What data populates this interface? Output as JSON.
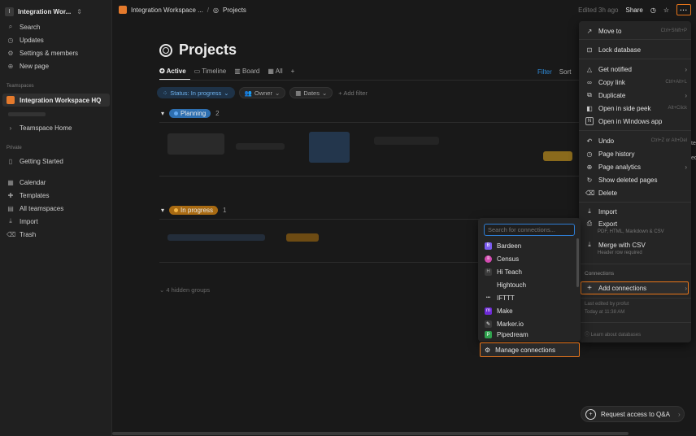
{
  "sidebar": {
    "workspace_badge": "I",
    "workspace_name": "Integration Wor...",
    "workspace_chevron": "⇕",
    "items_top": [
      {
        "icon": "search-icon",
        "glyph": "⌕",
        "label": "Search"
      },
      {
        "icon": "clock-icon",
        "glyph": "◷",
        "label": "Updates"
      },
      {
        "icon": "gear-icon",
        "glyph": "⚙",
        "label": "Settings & members"
      },
      {
        "icon": "plus-circle-icon",
        "glyph": "⊕",
        "label": "New page"
      }
    ],
    "teamspaces_label": "Teamspaces",
    "active_teamspace": "Integration Workspace HQ",
    "teamspace_home": "Teamspace Home",
    "private_label": "Private",
    "getting_started": "Getting Started",
    "items_bottom": [
      {
        "icon": "calendar-icon",
        "glyph": "▦",
        "label": "Calendar"
      },
      {
        "icon": "templates-icon",
        "glyph": "✚",
        "label": "Templates"
      },
      {
        "icon": "teamspaces-icon",
        "glyph": "▤",
        "label": "All teamspaces"
      },
      {
        "icon": "import-icon",
        "glyph": "⤓",
        "label": "Import"
      },
      {
        "icon": "trash-icon",
        "glyph": "🗑",
        "label": "Trash"
      }
    ]
  },
  "topbar": {
    "crumb_workspace": "Integration Workspace ...",
    "crumb_sep": "/",
    "crumb_page": "Projects",
    "edited": "Edited 3h ago",
    "share": "Share",
    "more": "···"
  },
  "main": {
    "title": "Projects",
    "views": [
      "Active",
      "Timeline",
      "Board",
      "All"
    ],
    "add_view": "+",
    "filter": "Filter",
    "sort": "Sort",
    "filters": {
      "status": "Status: In progress",
      "owner": "Owner",
      "dates": "Dates",
      "add": "+ Add filter"
    },
    "groups": [
      {
        "label": "Planning",
        "count": "2",
        "color": "#2e6fb0",
        "dot": "#62a8ef"
      },
      {
        "label": "In progress",
        "count": "1",
        "color": "#a86a12",
        "dot": "#f3b546"
      }
    ],
    "hidden_groups": "4 hidden groups"
  },
  "menu": {
    "items": [
      {
        "icon": "move-icon",
        "glyph": "↗",
        "label": "Move to",
        "shortcut": "Ctrl+Shift+P"
      },
      {
        "icon": "lock-icon",
        "glyph": "🔒",
        "label": "Lock database",
        "shortcut": ""
      },
      {
        "icon": "bell-icon",
        "glyph": "🔔",
        "label": "Get notified",
        "arrow": "›"
      },
      {
        "icon": "link-icon",
        "glyph": "🔗",
        "label": "Copy link",
        "shortcut": "Ctrl+Alt+L"
      },
      {
        "icon": "duplicate-icon",
        "glyph": "⧉",
        "label": "Duplicate",
        "arrow": "›"
      },
      {
        "icon": "side-peek-icon",
        "glyph": "◧",
        "label": "Open in side peek",
        "shortcut": "Alt+Click"
      },
      {
        "icon": "windows-app-icon",
        "glyph": "N",
        "label": "Open in Windows app",
        "shortcut": ""
      },
      {
        "icon": "undo-icon",
        "glyph": "↶",
        "label": "Undo",
        "shortcut": "Ctrl+Z or Alt+Del"
      },
      {
        "icon": "history-icon",
        "glyph": "◷",
        "label": "Page history",
        "shortcut": ""
      },
      {
        "icon": "analytics-icon",
        "glyph": "⊕",
        "label": "Page analytics",
        "arrow": "›"
      },
      {
        "icon": "deleted-pages-icon",
        "glyph": "↻",
        "label": "Show deleted pages",
        "shortcut": ""
      },
      {
        "icon": "delete-icon",
        "glyph": "🗑",
        "label": "Delete",
        "shortcut": ""
      },
      {
        "icon": "import-icon",
        "glyph": "⤓",
        "label": "Import",
        "shortcut": ""
      },
      {
        "icon": "export-icon",
        "glyph": "⎙",
        "label": "Export",
        "sub": "PDF, HTML, Markdown & CSV"
      },
      {
        "icon": "merge-icon",
        "glyph": "⤓",
        "label": "Merge with CSV",
        "sub": "Header row required"
      }
    ],
    "connections_label": "Connections",
    "add_connections": "Add connections",
    "add_connections_glyph": "+",
    "last_edited_by": "Last edited by profut",
    "last_edited_time": "Today at 11:38 AM",
    "learn": "Learn about databases"
  },
  "connections": {
    "placeholder": "Search for connections...",
    "items": [
      {
        "label": "Bardeen",
        "color": "#7b5cf0",
        "glyph": "B"
      },
      {
        "label": "Census",
        "color": "#d34bb1",
        "glyph": "≡"
      },
      {
        "label": "Hi Teach",
        "color": "#3a3a3a",
        "glyph": "H"
      },
      {
        "label": "Hightouch",
        "color": "#252525",
        "glyph": ""
      },
      {
        "label": "IFTTT",
        "color": "#252525",
        "glyph": "•••"
      },
      {
        "label": "Make",
        "color": "#6d2ad6",
        "glyph": "m"
      },
      {
        "label": "Marker.io",
        "color": "#3a3a3a",
        "glyph": "✎"
      },
      {
        "label": "Pipedream",
        "color": "#2fa24d",
        "glyph": "P"
      }
    ],
    "manage": "Manage connections"
  },
  "request_access": "Request access to Q&A",
  "request_arrow": "›",
  "peek_text_1": "te",
  "peek_text_2": "ec"
}
